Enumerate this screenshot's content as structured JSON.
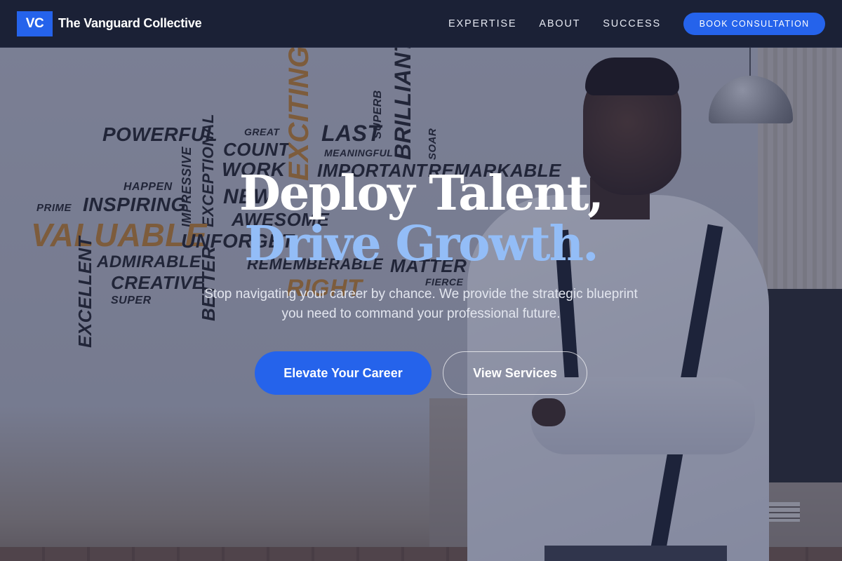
{
  "header": {
    "logo_mark": "VC",
    "brand_name": "The Vanguard Collective",
    "nav": [
      "EXPERTISE",
      "ABOUT",
      "SUCCESS"
    ],
    "cta_label": "BOOK CONSULTATION"
  },
  "hero": {
    "headline_line1": "Deploy Talent,",
    "headline_line2": "Drive Growth.",
    "subtitle": "Stop navigating your career by chance. We provide the strategic blueprint you need to command your professional future.",
    "primary_button": "Elevate Your Career",
    "secondary_button": "View Services"
  },
  "background_words": {
    "powerful": "POWERFUL",
    "great": "GREAT",
    "count": "COUNT",
    "work": "WORK",
    "exciting": "EXCITING",
    "last": "LAST",
    "meaningful": "MEANINGFUL",
    "superb": "SUPERB",
    "brilliant": "BRILLIANT",
    "soar": "SOAR",
    "important": "IMPORTANT",
    "remarkable": "REMARKABLE",
    "happen": "HAPPEN",
    "impressive": "IMPRESSIVE",
    "exceptional": "EXCEPTIONAL",
    "new": "NEW",
    "prime": "PRIME",
    "inspiring": "INSPIRING",
    "awesome": "AWESOME",
    "valuable": "VALUABLE",
    "unforgettable": "UNFORGET",
    "admirable": "ADMIRABLE",
    "remenberable": "REMEMBERABLE",
    "matter": "MATTER",
    "excellent": "EXCELLENT",
    "creative": "CREATIVE",
    "better": "BETTER",
    "fierce": "FIERCE",
    "super": "SUPER",
    "right": "RIGHT"
  },
  "colors": {
    "header_bg": "#1b2136",
    "accent": "#2563eb",
    "headline_accent": "#93bdf7",
    "word_orange": "#d48a27"
  }
}
